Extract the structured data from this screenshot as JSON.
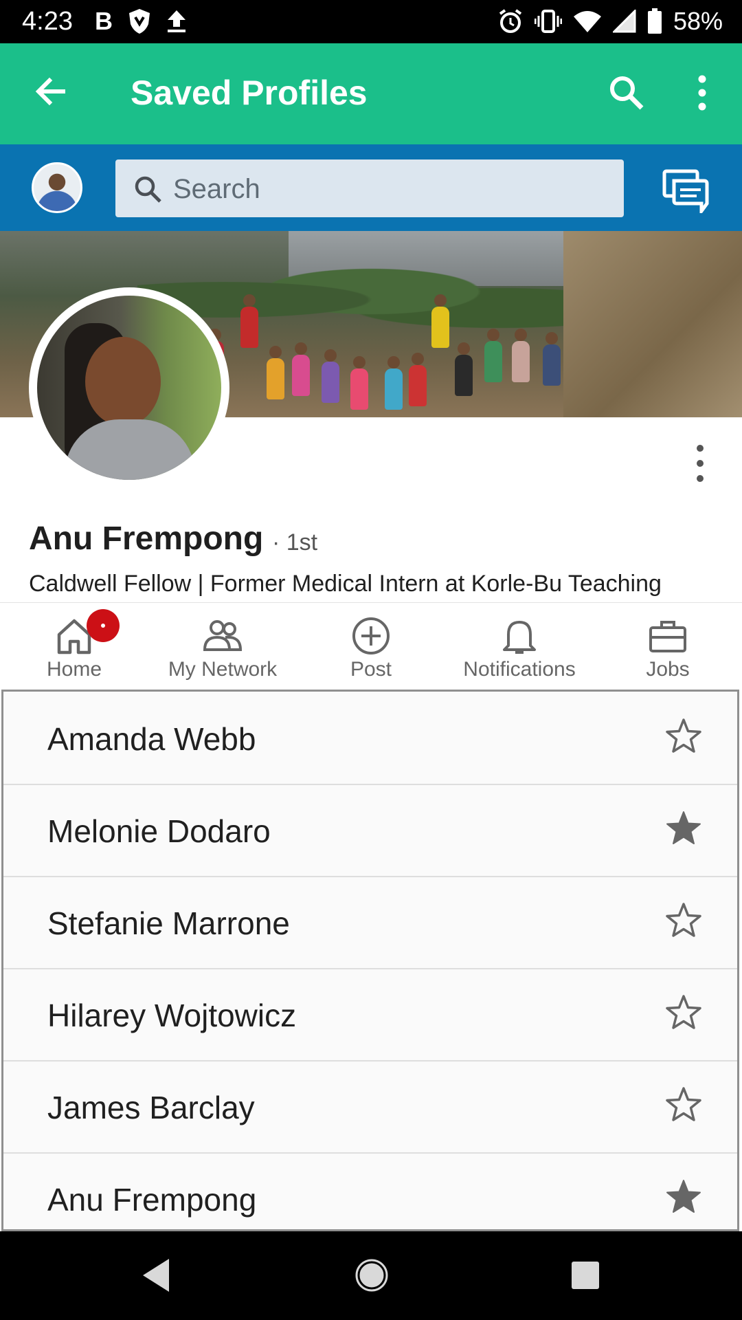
{
  "status_bar": {
    "time": "4:23",
    "left_icons": [
      "B",
      "shield-icon",
      "upload-icon"
    ],
    "battery": "58%"
  },
  "app_bar": {
    "title": "Saved Profiles",
    "color": "#1bbf8a"
  },
  "search": {
    "placeholder": "Search",
    "strip_color": "#0a73b1"
  },
  "profile": {
    "name": "Anu Frempong",
    "degree": "· 1st",
    "headline": "Caldwell Fellow | Former Medical Intern at Korle-Bu Teaching"
  },
  "bottom_nav": {
    "items": [
      {
        "label": "Home",
        "icon": "home-icon",
        "badge": true
      },
      {
        "label": "My Network",
        "icon": "network-icon"
      },
      {
        "label": "Post",
        "icon": "plus-circle-icon"
      },
      {
        "label": "Notifications",
        "icon": "bell-icon"
      },
      {
        "label": "Jobs",
        "icon": "briefcase-icon"
      }
    ]
  },
  "saved_profiles": [
    {
      "name": "Amanda Webb",
      "starred": false
    },
    {
      "name": "Melonie Dodaro",
      "starred": true
    },
    {
      "name": "Stefanie Marrone",
      "starred": false
    },
    {
      "name": "Hilarey Wojtowicz",
      "starred": false
    },
    {
      "name": "James Barclay",
      "starred": false
    },
    {
      "name": "Anu Frempong",
      "starred": true
    }
  ]
}
